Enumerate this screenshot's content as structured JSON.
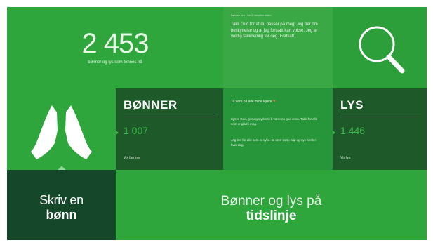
{
  "counter": {
    "value": "2 453",
    "caption": "bønner og lys som tennes nå"
  },
  "preview": {
    "meta": "Bønner om · for 2 minutter siden",
    "text": "Takk Gud for at du passer på meg! Jeg ber om beskyttelse og at jeg fortsatt kan vokse. Jeg er veldig takknemlig for deg. Fortsatt..."
  },
  "search": {
    "icon": "search-icon"
  },
  "hands": {
    "icon": "praying-hands-icon"
  },
  "bonner": {
    "title": "BØNNER",
    "count": "1 007",
    "link": "Vis bønner"
  },
  "lys": {
    "title": "LYS",
    "count": "1 446",
    "link": "Vis lys"
  },
  "messages": {
    "intro": "Ta vare på alle mine kjære ♥",
    "item1": "Kjære Gud, gi meg styrke til å være en god venn. Takk for alle som er glad i meg.",
    "item2": "Jeg ber for alle som er syke. Gi dem trøst, håp og nye krefter hver dag."
  },
  "write": {
    "line1": "Skriv en",
    "line2": "bønn"
  },
  "timeline": {
    "line1": "Bønner og lys på",
    "line2": "tidslinje"
  },
  "colors": {
    "green": "#2ea63b",
    "dark_green": "#1e5a29",
    "accent": "#3fb94d"
  }
}
